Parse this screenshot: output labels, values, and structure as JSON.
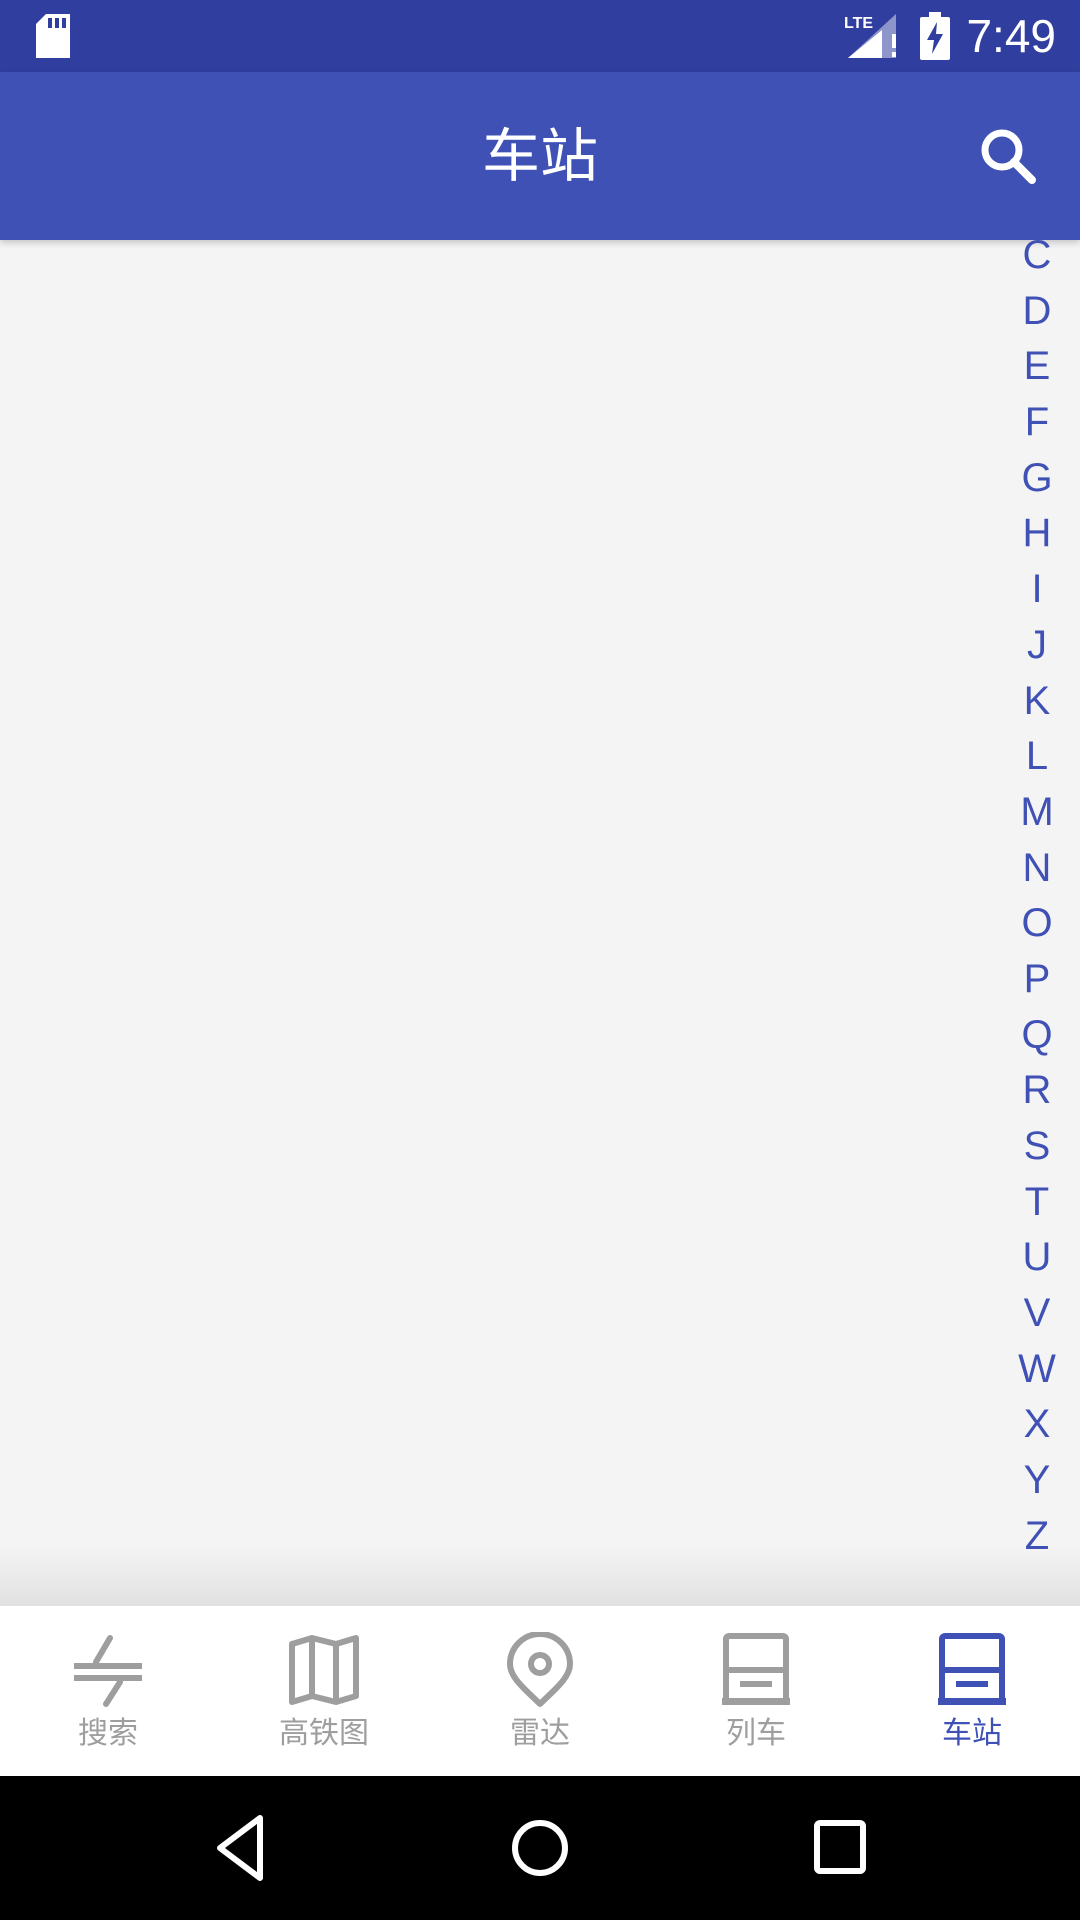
{
  "status_bar": {
    "network": "LTE",
    "time": "7:49"
  },
  "app_bar": {
    "title": "车站",
    "search_icon": "search-icon"
  },
  "index_letters": [
    "C",
    "D",
    "E",
    "F",
    "G",
    "H",
    "I",
    "J",
    "K",
    "L",
    "M",
    "N",
    "O",
    "P",
    "Q",
    "R",
    "S",
    "T",
    "U",
    "V",
    "W",
    "X",
    "Y",
    "Z"
  ],
  "bottom_nav": {
    "tabs": [
      {
        "label": "搜索",
        "icon": "swap-route-icon",
        "active": false
      },
      {
        "label": "高铁图",
        "icon": "map-icon",
        "active": false
      },
      {
        "label": "雷达",
        "icon": "location-pin-icon",
        "active": false
      },
      {
        "label": "列车",
        "icon": "train-icon",
        "active": false
      },
      {
        "label": "车站",
        "icon": "station-icon",
        "active": true
      }
    ]
  },
  "colors": {
    "status_bar": "#303f9f",
    "primary": "#3f51b5",
    "inactive": "#9e9e9e",
    "background": "#f4f4f4"
  }
}
